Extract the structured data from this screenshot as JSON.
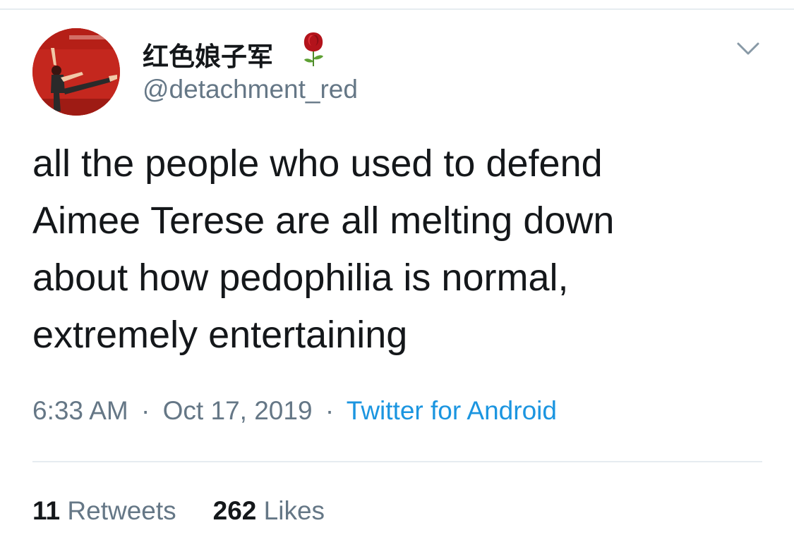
{
  "user": {
    "display_name": "红色娘子军",
    "handle": "@detachment_red",
    "avatar_icon": "profile-photo-dancer",
    "badge_icon": "rose-emoji"
  },
  "tweet": {
    "lines": [
      "all the people who used to defend",
      "Aimee Terese are all melting down",
      "about how pedophilia is normal,",
      "extremely entertaining"
    ]
  },
  "meta": {
    "time": "6:33 AM",
    "separator": "·",
    "date": "Oct 17, 2019",
    "source": "Twitter for Android"
  },
  "stats": {
    "retweets_count": "11",
    "retweets_label": "Retweets",
    "likes_count": "262",
    "likes_label": "Likes"
  },
  "colors": {
    "text_primary": "#14171a",
    "text_secondary": "#657786",
    "link_blue": "#1b95e0",
    "divider": "#e6ecf0",
    "avatar_red": "#c4271e"
  }
}
